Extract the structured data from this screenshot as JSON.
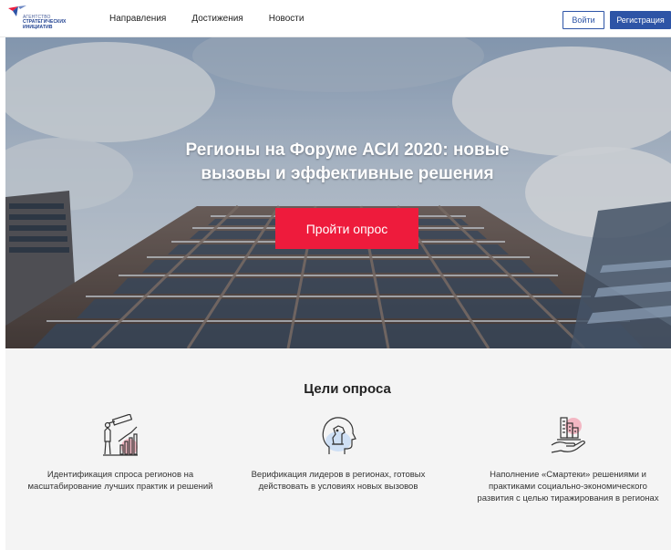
{
  "header": {
    "logo": {
      "line1": "агентство",
      "line2": "стратегических",
      "line3": "инициатив"
    },
    "nav": [
      "Направления",
      "Достижения",
      "Новости"
    ],
    "login_label": "Войти",
    "register_label": "Регистрация"
  },
  "hero": {
    "title_line1": "Регионы на Форуме АСИ 2020: новые",
    "title_line2": "вызовы и эффективные решения",
    "cta_label": "Пройти опрос"
  },
  "goals": {
    "title": "Цели опроса",
    "items": [
      {
        "icon": "telescope-chart-icon",
        "text": "Идентификация спроса регионов на масштабирование лучших практик и решений"
      },
      {
        "icon": "head-chess-knight-icon",
        "text": "Верификация лидеров в регионах, готовых действовать в условиях новых вызовов"
      },
      {
        "icon": "hand-city-icon",
        "text": "Наполнение «Смартеки» решениями и практиками социально-экономического развития с целью тиражирования в регионах"
      }
    ]
  },
  "colors": {
    "brand_blue": "#2d54a6",
    "cta_red": "#ee1b3c",
    "accent_pink": "#f3b7c3"
  }
}
